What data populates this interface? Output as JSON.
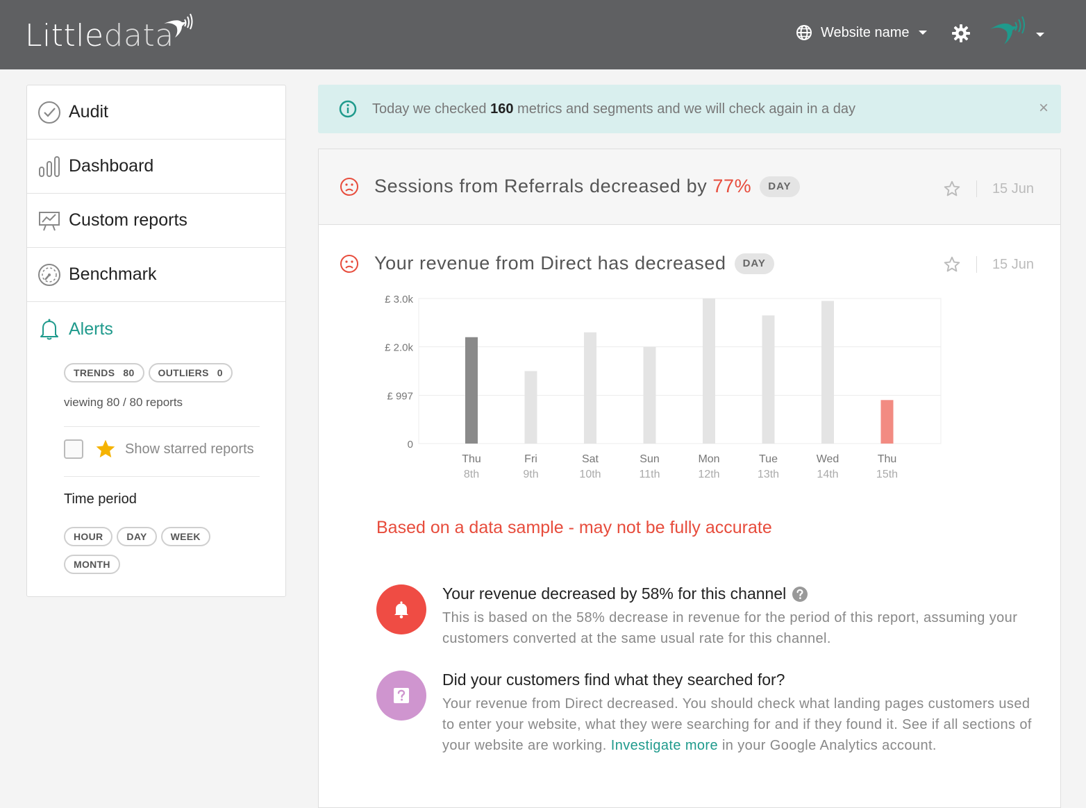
{
  "app": {
    "logo_dark": "Little",
    "logo_light": "data",
    "site_selector": "Website name",
    "brand_teal": "#1f9a8c",
    "alert_red": "#e74c3c",
    "header_bg": "#5f6062"
  },
  "sidebar": {
    "items": [
      {
        "label": "Audit",
        "icon": "check-circle-icon"
      },
      {
        "label": "Dashboard",
        "icon": "bar-chart-icon"
      },
      {
        "label": "Custom reports",
        "icon": "presentation-chart-icon"
      },
      {
        "label": "Benchmark",
        "icon": "gauge-icon"
      },
      {
        "label": "Alerts",
        "icon": "bell-icon"
      }
    ],
    "filters": {
      "trends_label": "TRENDS",
      "trends_count": "80",
      "outliers_label": "OUTLIERS",
      "outliers_count": "0"
    },
    "viewing": "viewing 80 / 80 reports",
    "starred_label": "Show starred reports",
    "starred_checked": false,
    "time_period_title": "Time period",
    "time_periods": [
      "HOUR",
      "DAY",
      "WEEK",
      "MONTH"
    ]
  },
  "banner": {
    "text_before": "Today we checked ",
    "count": "160",
    "text_after": " metrics and segments and we will check again in a day",
    "close": "×"
  },
  "alerts": [
    {
      "title_before": "Sessions from Referrals decreased by ",
      "pct": "77%",
      "period": "DAY",
      "date": "15 Jun"
    },
    {
      "title": "Your revenue from Direct has decreased",
      "period": "DAY",
      "date": "15 Jun",
      "sample_note": "Based on a data sample - may not be fully accurate",
      "insights": [
        {
          "icon": "bell-icon",
          "title": "Your revenue decreased by 58% for this channel",
          "description": "This is based on the 58% decrease in revenue for the period of this report, assuming your customers converted at the same usual rate for this channel."
        },
        {
          "icon": "question-icon",
          "title": "Did your customers find what they searched for?",
          "description_before": "Your revenue from Direct decreased. You should check what landing pages customers used to enter your website, what they were searching for and if they found it. See if all sections of your website are working. ",
          "link": "Investigate more",
          "description_after": " in your Google Analytics account."
        }
      ]
    }
  ],
  "chart_data": {
    "type": "bar",
    "categories": [
      "Thu 8th",
      "Fri 9th",
      "Sat 10th",
      "Sun 11th",
      "Mon 12th",
      "Tue 13th",
      "Wed 14th",
      "Thu 15th"
    ],
    "category_lines": [
      [
        "Thu",
        "8th"
      ],
      [
        "Fri",
        "9th"
      ],
      [
        "Sat",
        "10th"
      ],
      [
        "Sun",
        "11th"
      ],
      [
        "Mon",
        "12th"
      ],
      [
        "Tue",
        "13th"
      ],
      [
        "Wed",
        "14th"
      ],
      [
        "Thu",
        "15th"
      ]
    ],
    "values": [
      2200,
      1500,
      2300,
      2000,
      3000,
      2650,
      2950,
      900
    ],
    "bar_colors": [
      "#8a8a8a",
      "#e4e4e4",
      "#e4e4e4",
      "#e4e4e4",
      "#e4e4e4",
      "#e4e4e4",
      "#e4e4e4",
      "#f28b82"
    ],
    "y_ticks": [
      {
        "value": 0,
        "label": "0"
      },
      {
        "value": 997,
        "label": "£ 997"
      },
      {
        "value": 2000,
        "label": "£ 2.0k"
      },
      {
        "value": 3000,
        "label": "£ 3.0k"
      }
    ],
    "ylim": [
      0,
      3000
    ],
    "grid": true
  }
}
